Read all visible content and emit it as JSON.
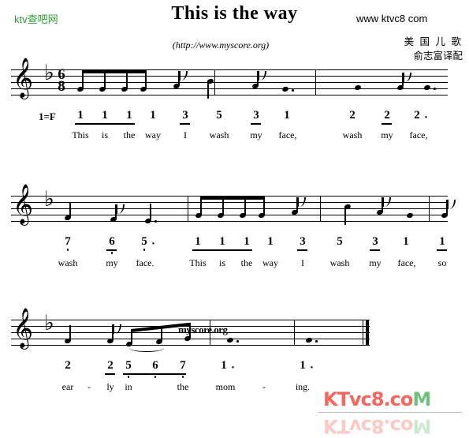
{
  "header": {
    "site_logo": "ktv查吧网",
    "title": "This is the way",
    "subtitle_link": "(http://www.myscore.org)",
    "site_url": "www ktvc8 com",
    "composer_line_1": "美 国 儿 歌",
    "composer_line_2": "俞志富译配",
    "logo_color": "#2e9b34"
  },
  "score": {
    "key_tag": "1=F",
    "clef": "treble-clef",
    "key_signature": "flat-sign",
    "time_signature": {
      "numerator": "6",
      "denominator": "8"
    },
    "staff_watermark": "myscore.org",
    "systems": [
      {
        "name": "system-1",
        "notes": [
          {
            "jianpu": "1",
            "lyric": "This",
            "octave": "mid",
            "dotted": false,
            "beamed": true
          },
          {
            "jianpu": "1",
            "lyric": "is",
            "octave": "mid",
            "dotted": false,
            "beamed": true
          },
          {
            "jianpu": "1",
            "lyric": "the",
            "octave": "mid",
            "dotted": false,
            "beamed": true
          },
          {
            "jianpu": "1",
            "lyric": "way",
            "octave": "mid",
            "dotted": false,
            "beamed": false
          },
          {
            "jianpu": "3",
            "lyric": "I",
            "octave": "mid",
            "dotted": false,
            "beamed": true
          },
          {
            "jianpu": "5",
            "lyric": "wash",
            "octave": "mid",
            "dotted": false,
            "beamed": false
          },
          {
            "jianpu": "3",
            "lyric": "my",
            "octave": "mid",
            "dotted": false,
            "beamed": true
          },
          {
            "jianpu": "1",
            "lyric": "face,",
            "octave": "mid",
            "dotted": true,
            "beamed": false
          },
          {
            "jianpu": "2",
            "lyric": "wash",
            "octave": "mid",
            "dotted": false,
            "beamed": false
          },
          {
            "jianpu": "2",
            "lyric": "my",
            "octave": "mid",
            "dotted": false,
            "beamed": true
          },
          {
            "jianpu": "2",
            "lyric": "face,",
            "octave": "mid",
            "dotted": true,
            "beamed": false
          }
        ]
      },
      {
        "name": "system-2",
        "notes": [
          {
            "jianpu": "7",
            "lyric": "wash",
            "octave": "low",
            "dotted": false,
            "beamed": false
          },
          {
            "jianpu": "6",
            "lyric": "my",
            "octave": "low",
            "dotted": false,
            "beamed": true
          },
          {
            "jianpu": "5",
            "lyric": "face.",
            "octave": "low",
            "dotted": true,
            "beamed": false
          },
          {
            "jianpu": "1",
            "lyric": "This",
            "octave": "mid",
            "dotted": false,
            "beamed": true
          },
          {
            "jianpu": "1",
            "lyric": "is",
            "octave": "mid",
            "dotted": false,
            "beamed": true
          },
          {
            "jianpu": "1",
            "lyric": "the",
            "octave": "mid",
            "dotted": false,
            "beamed": true
          },
          {
            "jianpu": "1",
            "lyric": "way",
            "octave": "mid",
            "dotted": false,
            "beamed": false
          },
          {
            "jianpu": "3",
            "lyric": "I",
            "octave": "mid",
            "dotted": false,
            "beamed": true
          },
          {
            "jianpu": "5",
            "lyric": "wash",
            "octave": "mid",
            "dotted": false,
            "beamed": false
          },
          {
            "jianpu": "3",
            "lyric": "my",
            "octave": "mid",
            "dotted": false,
            "beamed": true
          },
          {
            "jianpu": "1",
            "lyric": "face,",
            "octave": "mid",
            "dotted": false,
            "beamed": false
          },
          {
            "jianpu": "1",
            "lyric": "so",
            "octave": "mid",
            "dotted": false,
            "beamed": true
          }
        ]
      },
      {
        "name": "system-3",
        "notes": [
          {
            "jianpu": "2",
            "lyric": "ear",
            "octave": "mid",
            "dotted": false,
            "beamed": false
          },
          {
            "jianpu": "-",
            "lyric": "-",
            "octave": "mid",
            "dotted": false,
            "beamed": false
          },
          {
            "jianpu": "2",
            "lyric": "ly",
            "octave": "mid",
            "dotted": false,
            "beamed": true
          },
          {
            "jianpu": "5",
            "lyric": "in",
            "octave": "low",
            "dotted": false,
            "beamed": true
          },
          {
            "jianpu": "6",
            "lyric": "",
            "octave": "low",
            "dotted": false,
            "beamed": true
          },
          {
            "jianpu": "7",
            "lyric": "the",
            "octave": "low",
            "dotted": false,
            "beamed": true
          },
          {
            "jianpu": "1",
            "lyric": "mom",
            "octave": "mid",
            "dotted": true,
            "beamed": false
          },
          {
            "jianpu": "-",
            "lyric": "-",
            "octave": "mid",
            "dotted": false,
            "beamed": false
          },
          {
            "jianpu": "1",
            "lyric": "ing.",
            "octave": "mid",
            "dotted": true,
            "beamed": false
          }
        ]
      }
    ]
  },
  "watermark_bottom": {
    "text_red": "KTvc8.co",
    "text_green": "M",
    "color_red": "#f4665e",
    "color_green": "#6ec17a"
  }
}
